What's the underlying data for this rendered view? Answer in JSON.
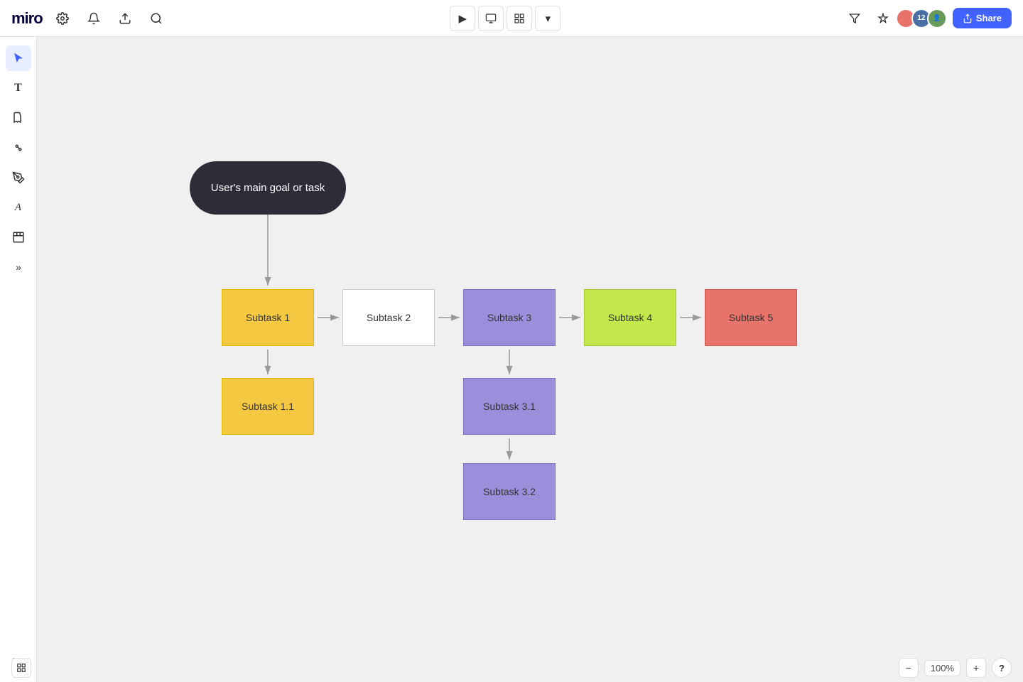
{
  "app": {
    "name": "miro"
  },
  "topbar": {
    "logo": "miro",
    "icons": [
      "⚙",
      "🔔",
      "↑",
      "🔍"
    ],
    "center_buttons": [
      "▶",
      "⬜",
      "☰",
      "▾"
    ],
    "right_icons": [
      "⇌",
      "✏"
    ],
    "share_label": "Share",
    "zoom_label": "100%",
    "help_label": "?"
  },
  "sidebar": {
    "tools": [
      {
        "name": "select",
        "icon": "cursor",
        "active": true
      },
      {
        "name": "text",
        "icon": "T"
      },
      {
        "name": "sticky",
        "icon": "sticky"
      },
      {
        "name": "connect",
        "icon": "connect"
      },
      {
        "name": "pen",
        "icon": "pen"
      },
      {
        "name": "text-tool",
        "icon": "A"
      },
      {
        "name": "frame",
        "icon": "frame"
      },
      {
        "name": "more",
        "icon": ">>"
      },
      {
        "name": "undo",
        "icon": "↩"
      }
    ]
  },
  "diagram": {
    "main_goal": {
      "label": "User's main goal or task",
      "shape": "pill",
      "color": "#2d2d3a",
      "text_color": "#ffffff"
    },
    "nodes": [
      {
        "id": "subtask1",
        "label": "Subtask 1",
        "color": "#f5c842",
        "border": "#e0b800"
      },
      {
        "id": "subtask2",
        "label": "Subtask 2",
        "color": "#ffffff",
        "border": "#cccccc"
      },
      {
        "id": "subtask3",
        "label": "Subtask 3",
        "color": "#9b8fdb",
        "border": "#8070c0"
      },
      {
        "id": "subtask4",
        "label": "Subtask 4",
        "color": "#c3e84b",
        "border": "#a8cc30"
      },
      {
        "id": "subtask5",
        "label": "Subtask 5",
        "color": "#e8736a",
        "border": "#d05a50"
      },
      {
        "id": "subtask11",
        "label": "Subtask 1.1",
        "color": "#f5c842",
        "border": "#e0b800"
      },
      {
        "id": "subtask31",
        "label": "Subtask 3.1",
        "color": "#9b8fdb",
        "border": "#8070c0"
      },
      {
        "id": "subtask32",
        "label": "Subtask 3.2",
        "color": "#9b8fdb",
        "border": "#8070c0"
      }
    ]
  }
}
